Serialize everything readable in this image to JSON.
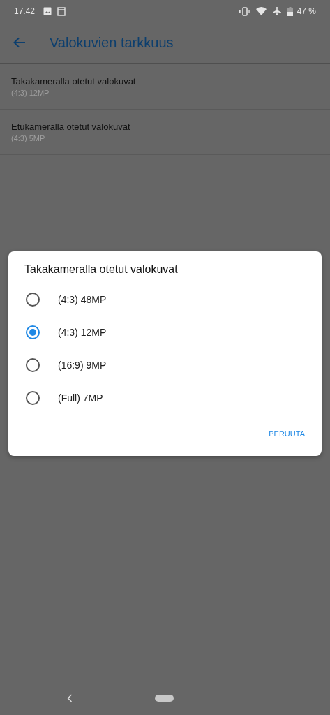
{
  "status_bar": {
    "time": "17.42",
    "battery": "47 %"
  },
  "app_bar": {
    "title": "Valokuvien tarkkuus"
  },
  "settings": [
    {
      "title": "Takakameralla otetut valokuvat",
      "summary": "(4:3) 12MP"
    },
    {
      "title": "Etukameralla otetut valokuvat",
      "summary": "(4:3) 5MP"
    }
  ],
  "dialog": {
    "title": "Takakameralla otetut valokuvat",
    "options": [
      {
        "label": "(4:3) 48MP",
        "selected": false
      },
      {
        "label": "(4:3) 12MP",
        "selected": true
      },
      {
        "label": "(16:9) 9MP",
        "selected": false
      },
      {
        "label": "(Full) 7MP",
        "selected": false
      }
    ],
    "buttons": [
      "PERUUTA"
    ]
  }
}
